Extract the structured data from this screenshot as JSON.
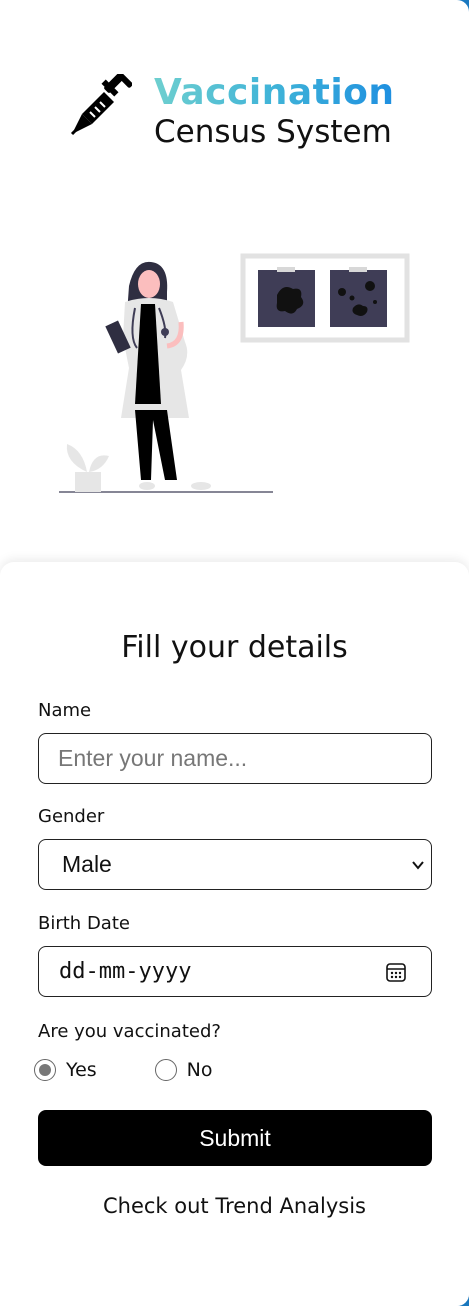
{
  "header": {
    "title": "Vaccination",
    "subtitle": "Census System",
    "logo_icon": "syringe-icon"
  },
  "illustration": {
    "subject": "doctor-with-xray-illustration"
  },
  "form": {
    "title": "Fill your details",
    "name_label": "Name",
    "name_placeholder": "Enter your name...",
    "name_value": "",
    "gender_label": "Gender",
    "gender_value": "Male",
    "birth_label": "Birth Date",
    "birth_placeholder": "dd-mm-yyyy",
    "vaccinated_label": "Are you vaccinated?",
    "vaccinated_options": [
      {
        "label": "Yes",
        "selected": true
      },
      {
        "label": "No",
        "selected": false
      }
    ],
    "submit_label": "Submit",
    "trend_link": "Check out Trend Analysis"
  },
  "colors": {
    "accent_start": "#6ecfcf",
    "accent_end": "#1e8fe0",
    "button_bg": "#000000",
    "page_edge": "#1a79c0"
  }
}
